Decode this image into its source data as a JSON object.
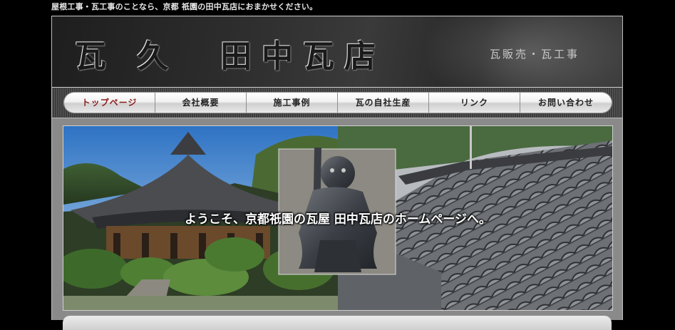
{
  "top_notice": "屋根工事・瓦工事のことなら、京都 祇園の田中瓦店におまかせください。",
  "header": {
    "logo_text": "瓦 久  田中瓦店",
    "tagline": "瓦販売・瓦工事"
  },
  "nav": {
    "items": [
      {
        "label": "トップページ",
        "active": true
      },
      {
        "label": "会社概要"
      },
      {
        "label": "施工事例"
      },
      {
        "label": "瓦の自社生産"
      },
      {
        "label": "リンク"
      },
      {
        "label": "お問い合わせ"
      }
    ]
  },
  "hero": {
    "welcome_text": "ようこそ、京都祇園の瓦屋 田中瓦店のホームページへ。"
  }
}
